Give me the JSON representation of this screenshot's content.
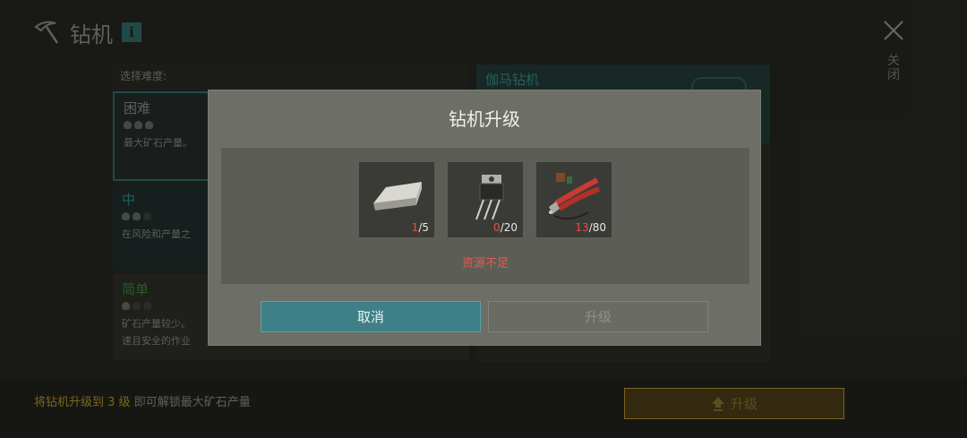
{
  "header": {
    "title": "钻机",
    "info_icon": "i",
    "close_label": "关闭"
  },
  "difficulty": {
    "label": "选择难度:",
    "options": [
      {
        "name": "困难",
        "desc": "最大矿石产量。"
      },
      {
        "name": "中",
        "desc": "在风险和产量之"
      },
      {
        "name": "简单",
        "desc_line1": "矿石产量较少。",
        "desc_line2": "速且安全的作业"
      }
    ]
  },
  "detail": {
    "title": "伽马钻机"
  },
  "footer": {
    "hint_prefix": "将钻机升级到",
    "hint_level": "3 级",
    "hint_suffix": "即可解锁最大矿石产量",
    "upgrade_label": "升级"
  },
  "modal": {
    "title": "钻机升级",
    "resources": [
      {
        "icon": "metal-ingot-icon",
        "have": "1",
        "need": "/5"
      },
      {
        "icon": "transistor-icon",
        "have": "0",
        "need": "/20"
      },
      {
        "icon": "pliers-parts-icon",
        "have": "13",
        "need": "/80"
      }
    ],
    "warning": "资源不足",
    "cancel_label": "取消",
    "upgrade_label": "升级"
  },
  "colors": {
    "accent": "#3e8088",
    "warning": "#e85a50",
    "gold": "#b8962e"
  }
}
